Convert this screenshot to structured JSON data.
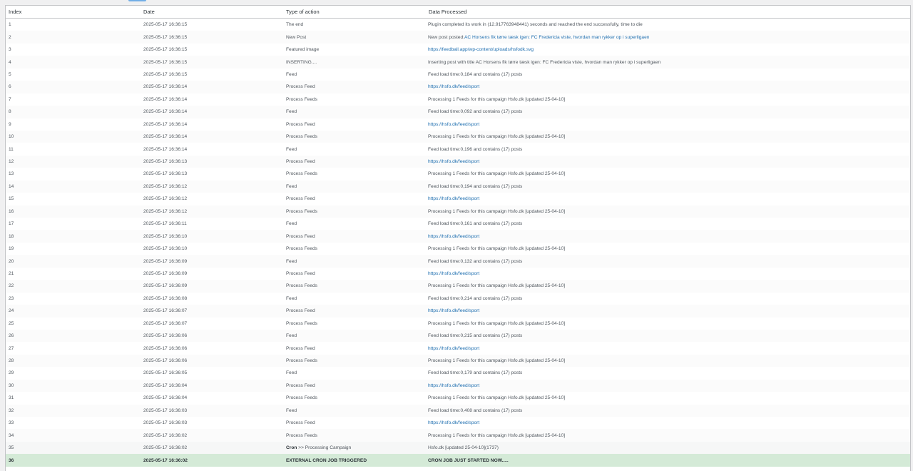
{
  "table": {
    "headers": {
      "index": "Index",
      "date": "Date",
      "type": "Type of action",
      "data": "Data Processed"
    },
    "rows": [
      {
        "index": "1",
        "date": "2025-05-17 16:36:15",
        "type": "The end",
        "data": "Plugin completed its work in (12.917763948441) seconds and reached the end successfully, time to die"
      },
      {
        "index": "2",
        "date": "2025-05-17 16:36:15",
        "type": "New Post",
        "data_prefix": "New post posted:",
        "data_link": "AC Horsens fik tørre tæsk igen: FC Fredericia viste, hvordan man rykker op i superligaen"
      },
      {
        "index": "3",
        "date": "2025-05-17 16:36:15",
        "type": "Featured image",
        "data_link": "https://feedball.app/wp-content/uploads/hsfodk.svg"
      },
      {
        "index": "4",
        "date": "2025-05-17 16:36:15",
        "type": "INSERTING....",
        "data": "Inserting post with title AC Horsens fik tørre tæsk igen: FC Fredericia viste, hvordan man rykker op i superligaen"
      },
      {
        "index": "5",
        "date": "2025-05-17 16:36:15",
        "type": "Feed",
        "data": "Feed load time:0,184 and contains (17) posts"
      },
      {
        "index": "6",
        "date": "2025-05-17 16:36:14",
        "type": "Process Feed",
        "data_link": "https://hsfo.dk/feed/sport"
      },
      {
        "index": "7",
        "date": "2025-05-17 16:36:14",
        "type": "Process Feeds",
        "data": "Processing 1 Feeds for this campaign Hsfo.dk [updated 25-04-10]"
      },
      {
        "index": "8",
        "date": "2025-05-17 16:36:14",
        "type": "Feed",
        "data": "Feed load time:0,092 and contains (17) posts"
      },
      {
        "index": "9",
        "date": "2025-05-17 16:36:14",
        "type": "Process Feed",
        "data_link": "https://hsfo.dk/feed/sport"
      },
      {
        "index": "10",
        "date": "2025-05-17 16:36:14",
        "type": "Process Feeds",
        "data": "Processing 1 Feeds for this campaign Hsfo.dk [updated 25-04-10]"
      },
      {
        "index": "11",
        "date": "2025-05-17 16:36:14",
        "type": "Feed",
        "data": "Feed load time:0,196 and contains (17) posts"
      },
      {
        "index": "12",
        "date": "2025-05-17 16:36:13",
        "type": "Process Feed",
        "data_link": "https://hsfo.dk/feed/sport"
      },
      {
        "index": "13",
        "date": "2025-05-17 16:36:13",
        "type": "Process Feeds",
        "data": "Processing 1 Feeds for this campaign Hsfo.dk [updated 25-04-10]"
      },
      {
        "index": "14",
        "date": "2025-05-17 16:36:12",
        "type": "Feed",
        "data": "Feed load time:0,194 and contains (17) posts"
      },
      {
        "index": "15",
        "date": "2025-05-17 16:36:12",
        "type": "Process Feed",
        "data_link": "https://hsfo.dk/feed/sport"
      },
      {
        "index": "16",
        "date": "2025-05-17 16:36:12",
        "type": "Process Feeds",
        "data": "Processing 1 Feeds for this campaign Hsfo.dk [updated 25-04-10]"
      },
      {
        "index": "17",
        "date": "2025-05-17 16:36:11",
        "type": "Feed",
        "data": "Feed load time:0,161 and contains (17) posts"
      },
      {
        "index": "18",
        "date": "2025-05-17 16:36:10",
        "type": "Process Feed",
        "data_link": "https://hsfo.dk/feed/sport"
      },
      {
        "index": "19",
        "date": "2025-05-17 16:36:10",
        "type": "Process Feeds",
        "data": "Processing 1 Feeds for this campaign Hsfo.dk [updated 25-04-10]"
      },
      {
        "index": "20",
        "date": "2025-05-17 16:36:09",
        "type": "Feed",
        "data": "Feed load time:0,132 and contains (17) posts"
      },
      {
        "index": "21",
        "date": "2025-05-17 16:36:09",
        "type": "Process Feed",
        "data_link": "https://hsfo.dk/feed/sport"
      },
      {
        "index": "22",
        "date": "2025-05-17 16:36:09",
        "type": "Process Feeds",
        "data": "Processing 1 Feeds for this campaign Hsfo.dk [updated 25-04-10]"
      },
      {
        "index": "23",
        "date": "2025-05-17 16:36:08",
        "type": "Feed",
        "data": "Feed load time:0,214 and contains (17) posts"
      },
      {
        "index": "24",
        "date": "2025-05-17 16:36:07",
        "type": "Process Feed",
        "data_link": "https://hsfo.dk/feed/sport"
      },
      {
        "index": "25",
        "date": "2025-05-17 16:36:07",
        "type": "Process Feeds",
        "data": "Processing 1 Feeds for this campaign Hsfo.dk [updated 25-04-10]"
      },
      {
        "index": "26",
        "date": "2025-05-17 16:36:06",
        "type": "Feed",
        "data": "Feed load time:0,215 and contains (17) posts"
      },
      {
        "index": "27",
        "date": "2025-05-17 16:36:06",
        "type": "Process Feed",
        "data_link": "https://hsfo.dk/feed/sport"
      },
      {
        "index": "28",
        "date": "2025-05-17 16:36:06",
        "type": "Process Feeds",
        "data": "Processing 1 Feeds for this campaign Hsfo.dk [updated 25-04-10]"
      },
      {
        "index": "29",
        "date": "2025-05-17 16:36:05",
        "type": "Feed",
        "data": "Feed load time:0,179 and contains (17) posts"
      },
      {
        "index": "30",
        "date": "2025-05-17 16:36:04",
        "type": "Process Feed",
        "data_link": "https://hsfo.dk/feed/sport"
      },
      {
        "index": "31",
        "date": "2025-05-17 16:36:04",
        "type": "Process Feeds",
        "data": "Processing 1 Feeds for this campaign Hsfo.dk [updated 25-04-10]"
      },
      {
        "index": "32",
        "date": "2025-05-17 16:36:03",
        "type": "Feed",
        "data": "Feed load time:0,408 and contains (17) posts"
      },
      {
        "index": "33",
        "date": "2025-05-17 16:36:03",
        "type": "Process Feed",
        "data_link": "https://hsfo.dk/feed/sport"
      },
      {
        "index": "34",
        "date": "2025-05-17 16:36:02",
        "type": "Process Feeds",
        "data": "Processing 1 Feeds for this campaign Hsfo.dk [updated 25-04-10]"
      },
      {
        "index": "35",
        "date": "2025-05-17 16:36:02",
        "type_bold": "Cron",
        "type": " >> Processing Campaign",
        "data": "Hsfo.dk [updated 25-04-10](1737)",
        "variant": "cron"
      },
      {
        "index": "36",
        "date": "2025-05-17 16:36:02",
        "type": "EXTERNAL CRON JOB TRIGGERED",
        "data": "CRON JOB JUST STARTED NOW.....",
        "variant": "highlight"
      }
    ]
  }
}
